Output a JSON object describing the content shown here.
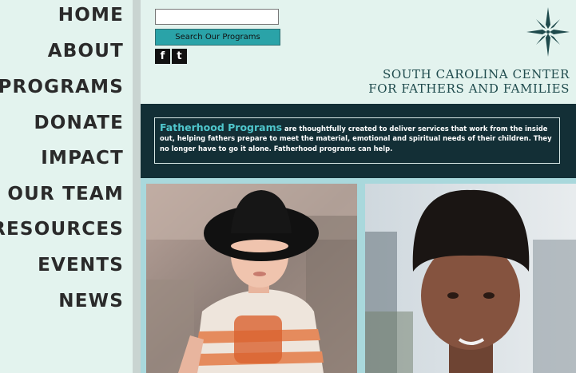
{
  "nav": {
    "items": [
      {
        "label": "HOME"
      },
      {
        "label": "ABOUT"
      },
      {
        "label": "PROGRAMS"
      },
      {
        "label": "DONATE"
      },
      {
        "label": "IMPACT"
      },
      {
        "label": "OUR TEAM"
      },
      {
        "label": "RESOURCES"
      },
      {
        "label": "EVENTS"
      },
      {
        "label": "NEWS"
      }
    ]
  },
  "header": {
    "search": {
      "value": "",
      "placeholder": ""
    },
    "search_button_label": "Search Our Programs",
    "social": {
      "facebook_glyph": "f",
      "twitter_glyph": "t"
    },
    "org_name_line1": "SOUTH CAROLINA CENTER",
    "org_name_line2": "FOR FATHERS AND FAMILIES",
    "logo_icon": "compass-star-icon"
  },
  "banner": {
    "title": "Fatherhood Programs",
    "text": " are thoughtfully created to deliver services that work from the inside out, helping fathers prepare to meet the material, emotional and spiritual needs of their children. They no longer have to go it alone. Fatherhood programs can help."
  },
  "colors": {
    "background": "#e3f3ee",
    "accent": "#2aa3a8",
    "banner": "#132f36",
    "title": "#4fc6cc"
  }
}
